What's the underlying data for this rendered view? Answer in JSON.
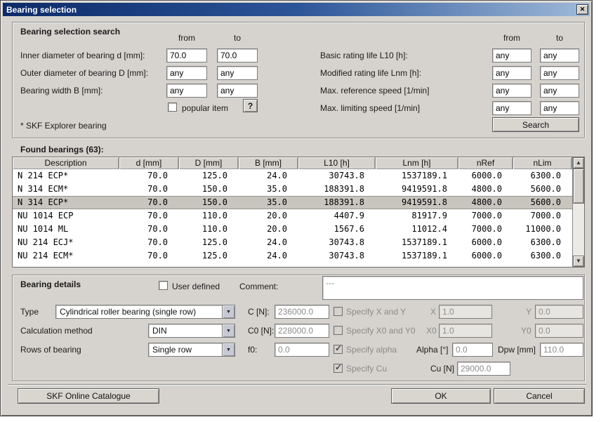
{
  "window": {
    "title": "Bearing selection"
  },
  "icons": {
    "close": "✕",
    "dropdown": "▼",
    "scroll_up": "▲",
    "scroll_down": "▼",
    "help": "?"
  },
  "colors": {
    "titlebar_left": "#0c2a69",
    "titlebar_right": "#9fbad9",
    "panel": "#d6d3ce",
    "selection": "#c8c5bf",
    "disabled_text": "#8c8c8c"
  },
  "search": {
    "heading": "Bearing selection search",
    "col_from": "from",
    "col_to": "to",
    "left_rows": [
      {
        "label": "Inner diameter of bearing d [mm]:",
        "from": "70.0",
        "to": "70.0"
      },
      {
        "label": "Outer diameter of bearing D [mm]:",
        "from": "any",
        "to": "any"
      },
      {
        "label": "Bearing width B [mm]:",
        "from": "any",
        "to": "any"
      }
    ],
    "right_rows": [
      {
        "label": "Basic rating life L10 [h]:",
        "from": "any",
        "to": "any"
      },
      {
        "label": "Modified rating life Lnm [h]:",
        "from": "any",
        "to": "any"
      },
      {
        "label": "Max. reference speed [1/min]",
        "from": "any",
        "to": "any"
      },
      {
        "label": "Max. limiting speed [1/min]",
        "from": "any",
        "to": "any"
      }
    ],
    "popular_item_label": "popular item",
    "popular_item_checked": false,
    "explorer_note": "* SKF Explorer bearing",
    "search_button": "Search"
  },
  "results": {
    "heading": "Found bearings (63):",
    "columns": [
      "Description",
      "d [mm]",
      "D [mm]",
      "B [mm]",
      "L10 [h]",
      "Lnm [h]",
      "nRef",
      "nLim"
    ],
    "rows": [
      {
        "selected": false,
        "cells": [
          "N 214 ECP*",
          "70.0",
          "125.0",
          "24.0",
          "30743.8",
          "1537189.1",
          "6000.0",
          "6300.0"
        ]
      },
      {
        "selected": false,
        "cells": [
          "N 314 ECM*",
          "70.0",
          "150.0",
          "35.0",
          "188391.8",
          "9419591.8",
          "4800.0",
          "5600.0"
        ]
      },
      {
        "selected": true,
        "cells": [
          "N 314 ECP*",
          "70.0",
          "150.0",
          "35.0",
          "188391.8",
          "9419591.8",
          "4800.0",
          "5600.0"
        ]
      },
      {
        "selected": false,
        "cells": [
          "NU 1014 ECP",
          "70.0",
          "110.0",
          "20.0",
          "4407.9",
          "81917.9",
          "7000.0",
          "7000.0"
        ]
      },
      {
        "selected": false,
        "cells": [
          "NU 1014 ML",
          "70.0",
          "110.0",
          "20.0",
          "1567.6",
          "11012.4",
          "7000.0",
          "11000.0"
        ]
      },
      {
        "selected": false,
        "cells": [
          "NU 214 ECJ*",
          "70.0",
          "125.0",
          "24.0",
          "30743.8",
          "1537189.1",
          "6000.0",
          "6300.0"
        ]
      },
      {
        "selected": false,
        "cells": [
          "NU 214 ECM*",
          "70.0",
          "125.0",
          "24.0",
          "30743.8",
          "1537189.1",
          "6000.0",
          "6300.0"
        ]
      }
    ]
  },
  "details": {
    "heading": "Bearing details",
    "user_defined_label": "User defined",
    "user_defined_checked": false,
    "comment_label": "Comment:",
    "comment_value": "---",
    "type_label": "Type",
    "type_value": "Cylindrical roller bearing (single row)",
    "calc_label": "Calculation method",
    "calc_value": "DIN",
    "rows_label": "Rows of bearing",
    "rows_value": "Single row",
    "c_label": "C [N]:",
    "c_value": "236000.0",
    "c0_label": "C0 [N]:",
    "c0_value": "228000.0",
    "f0_label": "f0:",
    "f0_value": "0.0",
    "specify_xy_label": "Specify X and Y",
    "specify_xy_checked": false,
    "x_label": "X",
    "x_value": "1.0",
    "y_label": "Y",
    "y_value": "0.0",
    "specify_x0y0_label": "Specify X0 and Y0",
    "specify_x0y0_checked": false,
    "x0_label": "X0",
    "x0_value": "1.0",
    "y0_label": "Y0",
    "y0_value": "0.0",
    "specify_alpha_label": "Specify alpha",
    "specify_alpha_checked": true,
    "alpha_label": "Alpha [°]",
    "alpha_value": "0.0",
    "dpw_label": "Dpw [mm]",
    "dpw_value": "110.0",
    "specify_cu_label": "Specify Cu",
    "specify_cu_checked": true,
    "cu_label": "Cu [N]",
    "cu_value": "29000.0"
  },
  "footer": {
    "catalogue_button": "SKF Online Catalogue",
    "ok_button": "OK",
    "cancel_button": "Cancel"
  }
}
